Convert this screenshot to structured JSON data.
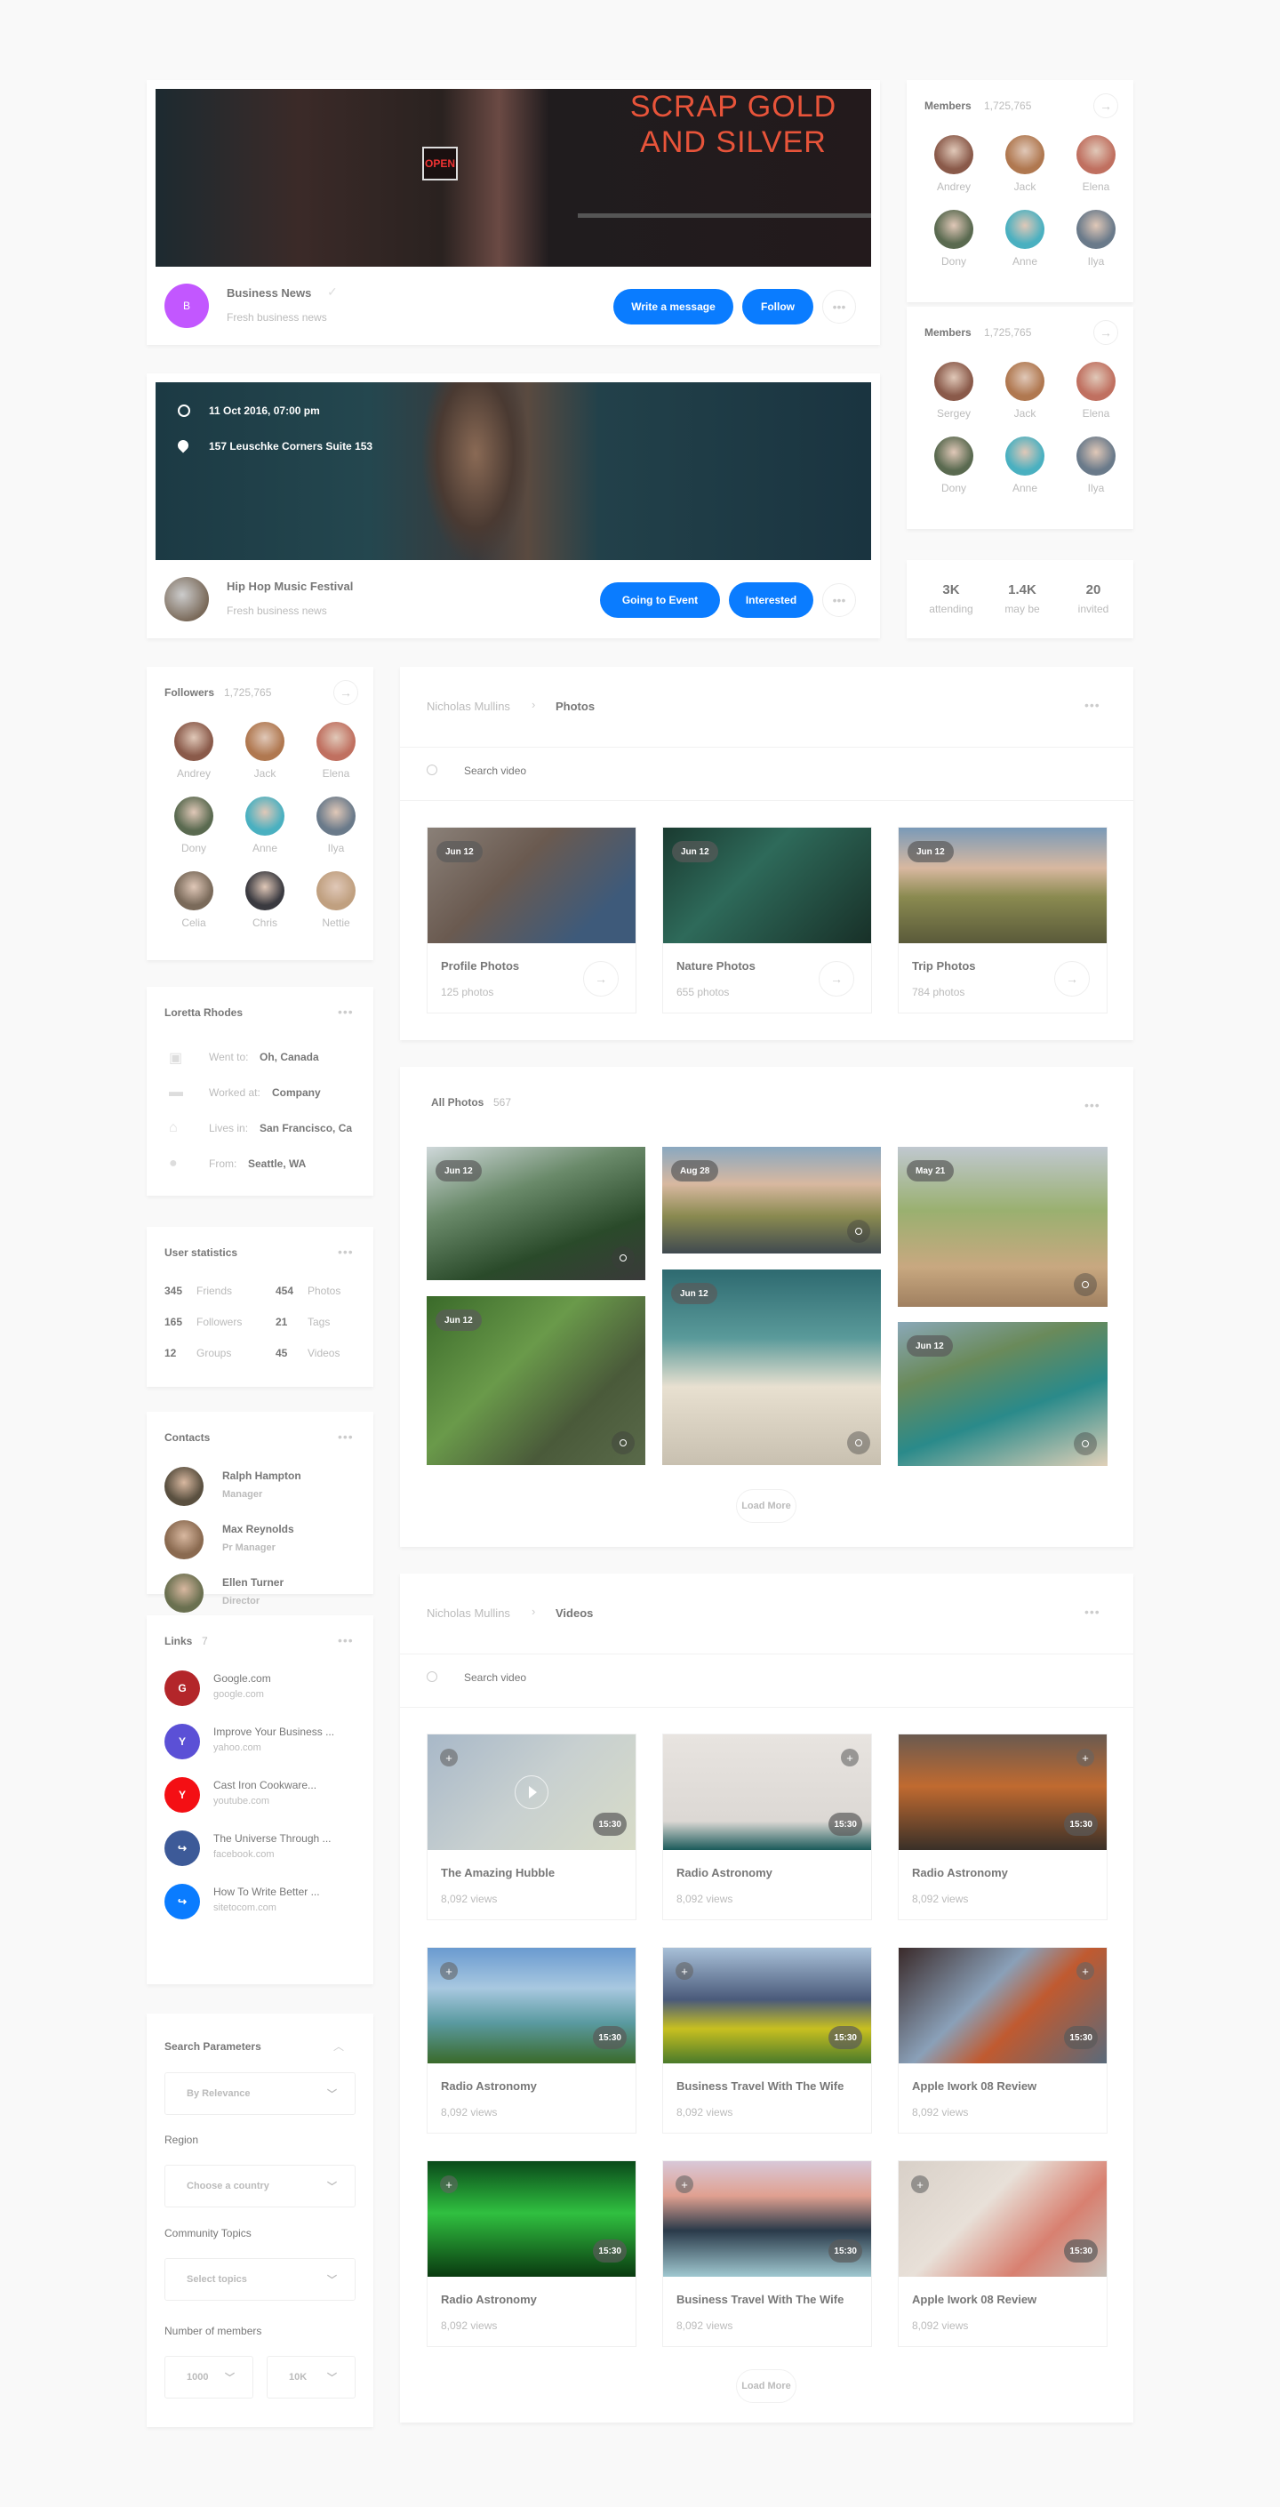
{
  "colors": {
    "accent": "#0a7cff",
    "background": "#f9f9f9",
    "card": "#ffffff",
    "text": "#777777",
    "muted": "#bbbbbb"
  },
  "business_card": {
    "avatar_letter": "B",
    "avatar_color": "#c257ff",
    "name": "Business News",
    "subtitle": "Fresh business news",
    "verified_icon": "check-icon",
    "write_message_label": "Write a message",
    "follow_label": "Follow",
    "more_icon": "more-dots-icon"
  },
  "event_card": {
    "datetime": "11 Oct 2016, 07:00 pm",
    "address": "157 Leuschke Corners Suite 153",
    "name": "Hip Hop Music Festival",
    "subtitle": "Fresh business news",
    "going_label": "Going to Event",
    "interested_label": "Interested"
  },
  "members_1": {
    "title": "Members",
    "count": "1,725,765",
    "people": [
      "Andrey",
      "Jack",
      "Elena",
      "Dony",
      "Anne",
      "Ilya"
    ]
  },
  "members_2": {
    "title": "Members",
    "count": "1,725,765",
    "people": [
      "Sergey",
      "Jack",
      "Elena",
      "Dony",
      "Anne",
      "Ilya"
    ]
  },
  "event_stats": [
    {
      "value": "3K",
      "label": "attending"
    },
    {
      "value": "1.4K",
      "label": "may be"
    },
    {
      "value": "20",
      "label": "invited"
    }
  ],
  "followers": {
    "title": "Followers",
    "count": "1,725,765",
    "people": [
      "Andrey",
      "Jack",
      "Elena",
      "Dony",
      "Anne",
      "Ilya",
      "Celia",
      "Chris",
      "Nettie"
    ]
  },
  "about": {
    "title": "Loretta Rhodes",
    "rows": [
      {
        "icon": "calendar-icon",
        "label": "Went to:",
        "value": "Oh, Canada"
      },
      {
        "icon": "briefcase-icon",
        "label": "Worked at:",
        "value": "Company"
      },
      {
        "icon": "home-icon",
        "label": "Lives in:",
        "value": "San Francisco, Ca"
      },
      {
        "icon": "location-pin-icon",
        "label": "From:",
        "value": "Seattle, WA"
      }
    ]
  },
  "user_stats": {
    "title": "User statistics",
    "items": [
      {
        "value": "345",
        "label": "Friends"
      },
      {
        "value": "454",
        "label": "Photos"
      },
      {
        "value": "165",
        "label": "Followers"
      },
      {
        "value": "21",
        "label": "Tags"
      },
      {
        "value": "12",
        "label": "Groups"
      },
      {
        "value": "45",
        "label": "Videos"
      }
    ]
  },
  "contacts": {
    "title": "Contacts",
    "items": [
      {
        "name": "Ralph Hampton",
        "role": "Manager"
      },
      {
        "name": "Max Reynolds",
        "role": "Pr Manager"
      },
      {
        "name": "Ellen Turner",
        "role": "Director"
      }
    ]
  },
  "links": {
    "title": "Links",
    "count": "7",
    "items": [
      {
        "letter": "G",
        "color": "#b3262a",
        "title": "Google.com",
        "domain": "google.com"
      },
      {
        "letter": "Y",
        "color": "#5b50d6",
        "title": "Improve Your Business ...",
        "domain": "yahoo.com"
      },
      {
        "letter": "Y",
        "color": "#f40f14",
        "title": "Cast Iron Cookware...",
        "domain": "youtube.com"
      },
      {
        "letter": "↪",
        "color": "#3d5a98",
        "title": "The Universe Through ...",
        "domain": "facebook.com"
      },
      {
        "letter": "↪",
        "color": "#0a7cff",
        "title": "How To Write Better ...",
        "domain": "sitetocom.com"
      }
    ]
  },
  "search_params": {
    "title": "Search Parameters",
    "sort_value": "By Relevance",
    "region_label": "Region",
    "region_placeholder": "Choose a country",
    "topics_label": "Community Topics",
    "topics_placeholder": "Select topics",
    "members_label": "Number of members",
    "members_min": "1000",
    "members_max": "10K"
  },
  "photos_section": {
    "breadcrumb_root": "Nicholas Mullins",
    "breadcrumb_current": "Photos",
    "search_placeholder": "Search video",
    "albums": [
      {
        "date": "Jun 12",
        "title": "Profile Photos",
        "count": "125 photos"
      },
      {
        "date": "Jun 12",
        "title": "Nature Photos",
        "count": "655 photos"
      },
      {
        "date": "Jun 12",
        "title": "Trip Photos",
        "count": "784 photos"
      }
    ]
  },
  "all_photos": {
    "title": "All Photos",
    "count": "567",
    "tiles": [
      {
        "date": "Jun 12"
      },
      {
        "date": "Jun 12"
      },
      {
        "date": "Aug 28"
      },
      {
        "date": "Jun 12"
      },
      {
        "date": "May 21"
      },
      {
        "date": "Jun 12"
      }
    ],
    "load_more": "Load More"
  },
  "videos_section": {
    "breadcrumb_root": "Nicholas Mullins",
    "breadcrumb_current": "Videos",
    "search_placeholder": "Search video",
    "videos": [
      {
        "title": "The Amazing Hubble",
        "views": "8,092 views",
        "duration": "15:30"
      },
      {
        "title": "Radio Astronomy",
        "views": "8,092 views",
        "duration": "15:30"
      },
      {
        "title": "Radio Astronomy",
        "views": "8,092 views",
        "duration": "15:30"
      },
      {
        "title": "Radio Astronomy",
        "views": "8,092 views",
        "duration": "15:30"
      },
      {
        "title": "Business Travel With The Wife",
        "views": "8,092 views",
        "duration": "15:30"
      },
      {
        "title": "Apple Iwork 08 Review",
        "views": "8,092 views",
        "duration": "15:30"
      },
      {
        "title": "Radio Astronomy",
        "views": "8,092 views",
        "duration": "15:30"
      },
      {
        "title": "Business Travel With The Wife",
        "views": "8,092 views",
        "duration": "15:30"
      },
      {
        "title": "Apple Iwork 08 Review",
        "views": "8,092 views",
        "duration": "15:30"
      }
    ],
    "load_more": "Load More"
  }
}
